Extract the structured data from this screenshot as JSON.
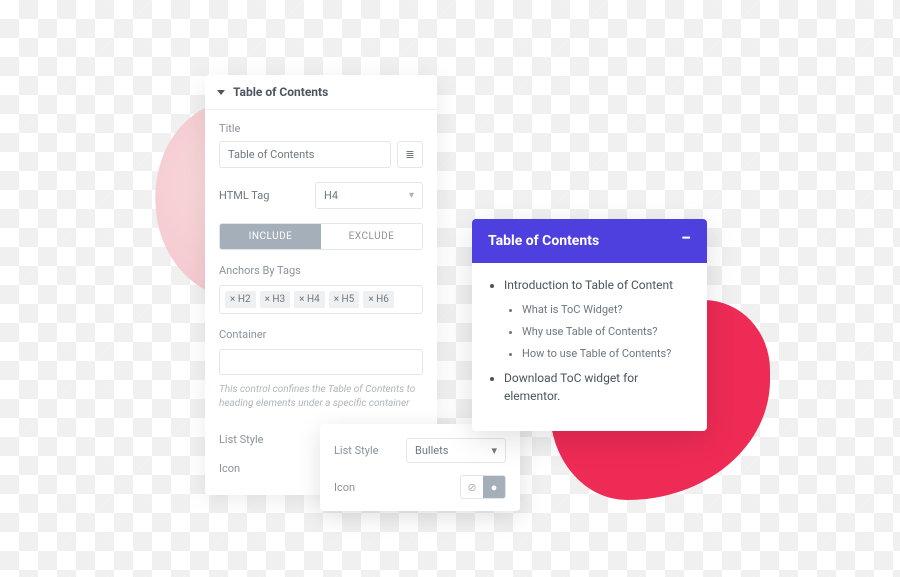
{
  "panel": {
    "header": "Table of Contents",
    "title_label": "Title",
    "title_value": "Table of Contents",
    "html_tag_label": "HTML Tag",
    "html_tag_value": "H4",
    "tabs": {
      "include": "INCLUDE",
      "exclude": "EXCLUDE"
    },
    "anchors_label": "Anchors By Tags",
    "anchors": [
      "× H2",
      "× H3",
      "× H4",
      "× H5",
      "× H6"
    ],
    "container_label": "Container",
    "container_hint": "This control confines the Table of Contents to heading elements under a specific container",
    "list_style_label": "List Style",
    "icon_label": "Icon"
  },
  "popover": {
    "list_style_label": "List Style",
    "list_style_value": "Bullets",
    "icon_label": "Icon"
  },
  "preview": {
    "title": "Table of Contents",
    "items": {
      "intro": "Introduction to Table of Content",
      "sub1": "What is ToC Widget?",
      "sub2": "Why use Table of Contents?",
      "sub3": "How to use Table of Contents?",
      "download": "Download ToC widget for elementor."
    }
  }
}
